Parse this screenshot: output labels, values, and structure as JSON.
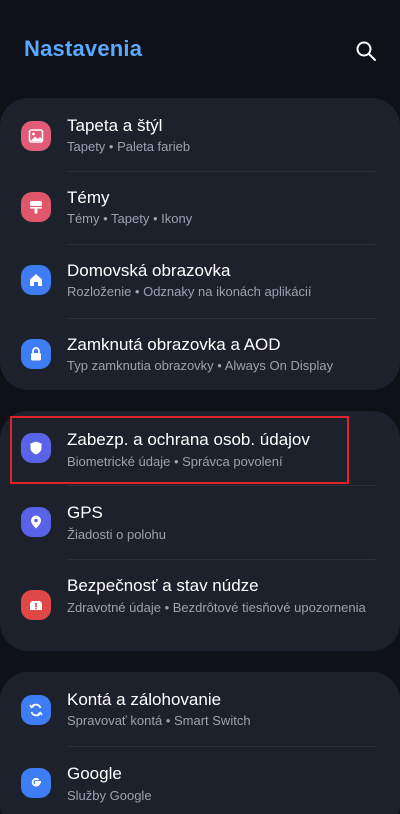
{
  "header": {
    "title": "Nastavenia",
    "search_icon": "search-icon"
  },
  "colors": {
    "title_blue": "#5aa8ff",
    "card_bg": "#1c212b",
    "highlight_red": "#e0232a"
  },
  "cards": [
    {
      "items": [
        {
          "title": "Tapeta a štýl",
          "subtitle": "Tapety  •  Paleta farieb",
          "icon": "wallpaper-icon",
          "icon_color": "#e05c78"
        },
        {
          "title": "Témy",
          "subtitle": "Témy  •  Tapety  •  Ikony",
          "icon": "themes-icon",
          "icon_color": "#e0566a"
        },
        {
          "title": "Domovská obrazovka",
          "subtitle": "Rozloženie  •  Odznaky na ikonách aplikácií",
          "icon": "home-icon",
          "icon_color": "#3f7df4"
        },
        {
          "title": "Zamknutá obrazovka a AOD",
          "subtitle": "Typ zamknutia obrazovky  •  Always On Display",
          "icon": "lock-icon",
          "icon_color": "#3f7df4"
        }
      ]
    },
    {
      "items": [
        {
          "title": "Zabezp. a ochrana osob. údajov",
          "subtitle": "Biometrické údaje  •  Správca povolení",
          "icon": "shield-icon",
          "icon_color": "#5a63e8"
        },
        {
          "title": "GPS",
          "subtitle": "Žiadosti o polohu",
          "icon": "location-pin-icon",
          "icon_color": "#5a63e8"
        },
        {
          "title": "Bezpečnosť a stav núdze",
          "subtitle": "Zdravotné údaje  •  Bezdrôtové tiesňové upozornenia",
          "icon": "emergency-icon",
          "icon_color": "#e04848"
        }
      ]
    },
    {
      "items": [
        {
          "title": "Kontá a zálohovanie",
          "subtitle": "Spravovať kontá  •  Smart Switch",
          "icon": "sync-icon",
          "icon_color": "#3f7df4"
        },
        {
          "title": "Google",
          "subtitle": "Služby Google",
          "icon": "google-icon",
          "icon_color": "#3f7df4"
        }
      ]
    }
  ]
}
